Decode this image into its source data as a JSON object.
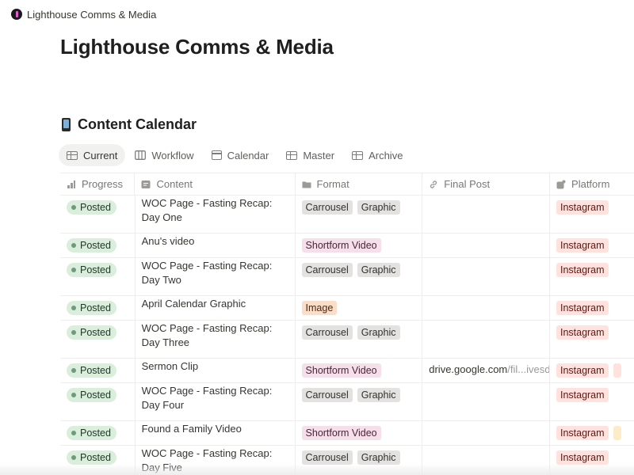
{
  "breadcrumb": {
    "label": "Lighthouse Comms & Media"
  },
  "page": {
    "title": "Lighthouse Comms & Media"
  },
  "database": {
    "title": "Content Calendar",
    "icon": "mobile-phone-icon"
  },
  "views": [
    {
      "label": "Current",
      "icon": "table-icon",
      "active": true
    },
    {
      "label": "Workflow",
      "icon": "board-icon",
      "active": false
    },
    {
      "label": "Calendar",
      "icon": "calendar-icon",
      "active": false
    },
    {
      "label": "Master",
      "icon": "table-icon",
      "active": false
    },
    {
      "label": "Archive",
      "icon": "table-icon",
      "active": false
    }
  ],
  "columns": {
    "progress": {
      "label": "Progress",
      "icon": "status-bars-icon"
    },
    "content": {
      "label": "Content",
      "icon": "title-icon"
    },
    "format": {
      "label": "Format",
      "icon": "folder-icon"
    },
    "final_post": {
      "label": "Final Post",
      "icon": "link-icon"
    },
    "platform": {
      "label": "Platform",
      "icon": "platform-icon"
    }
  },
  "rows": [
    {
      "progress": "Posted",
      "content": "WOC Page - Fasting Recap: Day One",
      "format": [
        "Carrousel",
        "Graphic"
      ],
      "final_post": "",
      "platform": [
        "Instagram"
      ]
    },
    {
      "progress": "Posted",
      "content": "Anu's video",
      "format": [
        "Shortform Video"
      ],
      "final_post": "",
      "platform": [
        "Instagram"
      ]
    },
    {
      "progress": "Posted",
      "content": "WOC Page - Fasting Recap: Day Two",
      "format": [
        "Carrousel",
        "Graphic"
      ],
      "final_post": "",
      "platform": [
        "Instagram"
      ]
    },
    {
      "progress": "Posted",
      "content": "April Calendar Graphic",
      "format": [
        "Image"
      ],
      "final_post": "",
      "platform": [
        "Instagram"
      ]
    },
    {
      "progress": "Posted",
      "content": "WOC Page - Fasting Recap: Day Three",
      "format": [
        "Carrousel",
        "Graphic"
      ],
      "final_post": "",
      "platform": [
        "Instagram"
      ]
    },
    {
      "progress": "Posted",
      "content": "Sermon Clip",
      "format": [
        "Shortform Video"
      ],
      "final_post": {
        "domain": "drive.google.com",
        "path": "/fil...ivesdk"
      },
      "platform": [
        "Instagram"
      ]
    },
    {
      "progress": "Posted",
      "content": "WOC Page - Fasting Recap: Day Four",
      "format": [
        "Carrousel",
        "Graphic"
      ],
      "final_post": "",
      "platform": [
        "Instagram"
      ]
    },
    {
      "progress": "Posted",
      "content": "Found a Family Video",
      "format": [
        "Shortform Video"
      ],
      "final_post": "",
      "platform": [
        "Instagram"
      ]
    },
    {
      "progress": "Posted",
      "content": "WOC Page - Fasting Recap: Day Five",
      "format": [
        "Carrousel",
        "Graphic"
      ],
      "final_post": "",
      "platform": [
        "Instagram"
      ]
    }
  ],
  "colors": {
    "status_posted_bg": "#dbeddb",
    "status_posted_dot": "#6c9b7d",
    "tag_gray": "#e3e2e0",
    "tag_pink": "#f5e0e9",
    "tag_orange": "#fadec9",
    "tag_platform": "#ffe2dd"
  }
}
